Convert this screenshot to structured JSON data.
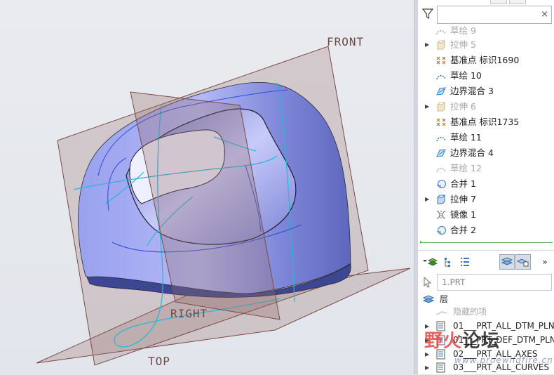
{
  "viewport": {
    "planes": {
      "front": "FRONT",
      "right": "RIGHT",
      "top": "TOP"
    }
  },
  "model_tree": {
    "search": {
      "value": "",
      "clear_icon": "×"
    },
    "items": [
      {
        "label": "草绘 9",
        "icon": "sketch-icon",
        "dim": true,
        "expand": false
      },
      {
        "label": "拉伸 5",
        "icon": "extrude-icon",
        "dim": true,
        "expand": true
      },
      {
        "label": "基准点 标识1690",
        "icon": "datum-point-icon",
        "dim": false,
        "expand": false
      },
      {
        "label": "草绘 10",
        "icon": "sketch-icon",
        "dim": false,
        "expand": false
      },
      {
        "label": "边界混合 3",
        "icon": "boundary-blend-icon",
        "dim": false,
        "expand": false
      },
      {
        "label": "拉伸 6",
        "icon": "extrude-icon",
        "dim": true,
        "expand": true
      },
      {
        "label": "基准点 标识1735",
        "icon": "datum-point-icon",
        "dim": false,
        "expand": false
      },
      {
        "label": "草绘 11",
        "icon": "sketch-icon",
        "dim": false,
        "expand": false
      },
      {
        "label": "边界混合 4",
        "icon": "boundary-blend-icon",
        "dim": false,
        "expand": false
      },
      {
        "label": "草绘 12",
        "icon": "sketch-icon",
        "dim": true,
        "expand": false
      },
      {
        "label": "合并 1",
        "icon": "merge-icon",
        "dim": false,
        "expand": false
      },
      {
        "label": "拉伸 7",
        "icon": "extrude-icon",
        "dim": false,
        "expand": true
      },
      {
        "label": "镜像 1",
        "icon": "mirror-icon",
        "dim": false,
        "expand": false
      },
      {
        "label": "合并 2",
        "icon": "merge-icon",
        "dim": false,
        "expand": false
      }
    ]
  },
  "layer_panel": {
    "toolbar_more": "»",
    "model": "1.PRT",
    "header": "层",
    "items": [
      {
        "label": "隐藏的项",
        "dim": true
      },
      {
        "label": "01___PRT_ALL_DTM_PLN",
        "dim": false
      },
      {
        "label": "01___PRT_DEF_DTM_PLN",
        "dim": false
      },
      {
        "label": "02___PRT_ALL_AXES",
        "dim": false
      },
      {
        "label": "03___PRT_ALL_CURVES",
        "dim": false
      }
    ]
  },
  "watermark": {
    "part_a": "野火",
    "part_b": "论坛",
    "url": "www.proewildfire.cn"
  },
  "colors": {
    "accent_green": "#53b153",
    "body_blue": "#8f98e6",
    "curve_cyan": "#26b7d4",
    "plane_edge": "#7a4a4a"
  }
}
